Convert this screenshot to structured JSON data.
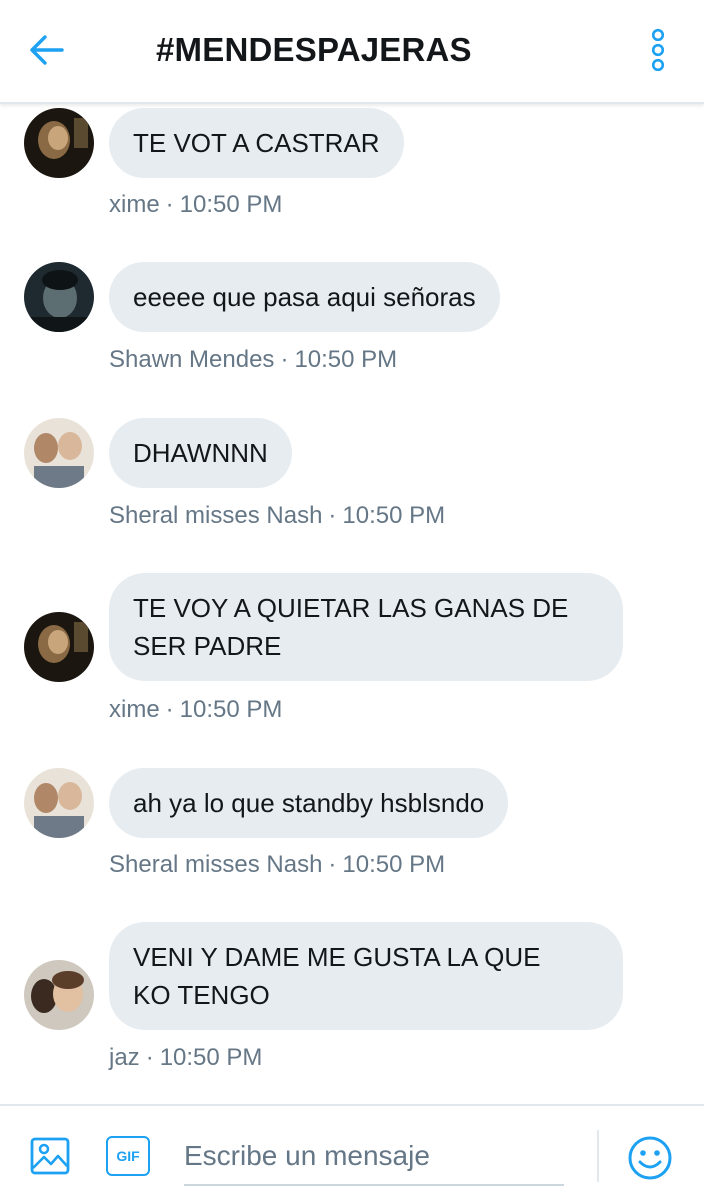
{
  "header": {
    "title": "#MENDESPAJERAS",
    "back_icon": "arrow-left-icon",
    "menu_icon": "vertical-dots-icon"
  },
  "messages": [
    {
      "text": "TE VOT A CASTRAR",
      "author": "xime",
      "time": "10:50 PM",
      "avatar": "avatar-xime"
    },
    {
      "text": "eeeee que pasa aqui señoras",
      "author": "Shawn Mendes",
      "time": "10:50 PM",
      "avatar": "avatar-shawn"
    },
    {
      "text": "DHAWNNN",
      "author": "Sheral misses Nash",
      "time": "10:50 PM",
      "avatar": "avatar-sheral"
    },
    {
      "text_line1": "TE VOY A QUIETAR LAS GANAS DE",
      "text_line2": "SER PADRE",
      "author": "xime",
      "time": "10:50 PM",
      "avatar": "avatar-xime"
    },
    {
      "text": "ah ya lo que standby hsblsndo",
      "author": "Sheral misses Nash",
      "time": "10:50 PM",
      "avatar": "avatar-sheral"
    },
    {
      "text_line1": "VENI Y DAME ME GUSTA LA QUE",
      "text_line2": "KO TENGO",
      "author": "jaz",
      "time": "10:50 PM",
      "avatar": "avatar-jaz"
    }
  ],
  "composer": {
    "placeholder": "Escribe un mensaje",
    "gif_label": "GIF",
    "image_icon": "image-icon",
    "emoji_icon": "emoji-icon"
  },
  "colors": {
    "accent": "#1da1f2",
    "bubble": "#e6ecf0",
    "meta_text": "#657786"
  }
}
